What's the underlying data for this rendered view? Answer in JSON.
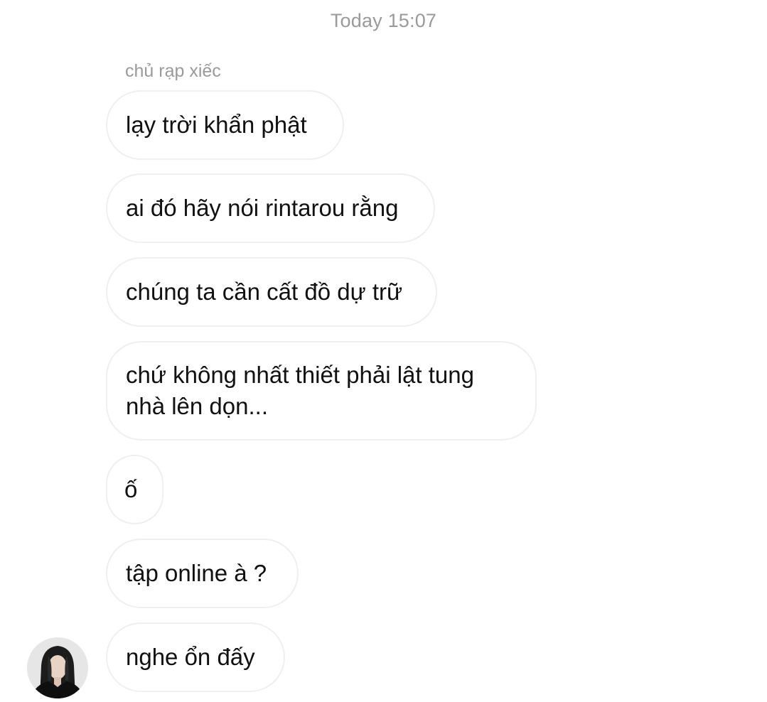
{
  "chat": {
    "timestamp": "Today 15:07",
    "sender_name": "chủ rạp xiếc",
    "messages": [
      {
        "text": "lạy trời khẩn phật"
      },
      {
        "text": "ai đó hãy nói rintarou rằng"
      },
      {
        "text": "chúng ta cần cất đồ dự trữ"
      },
      {
        "text": "chứ không nhất thiết phải lật tung nhà lên dọn..."
      },
      {
        "text": "ố"
      },
      {
        "text": "tập online à ?"
      },
      {
        "text": "nghe ổn đấy"
      }
    ]
  }
}
